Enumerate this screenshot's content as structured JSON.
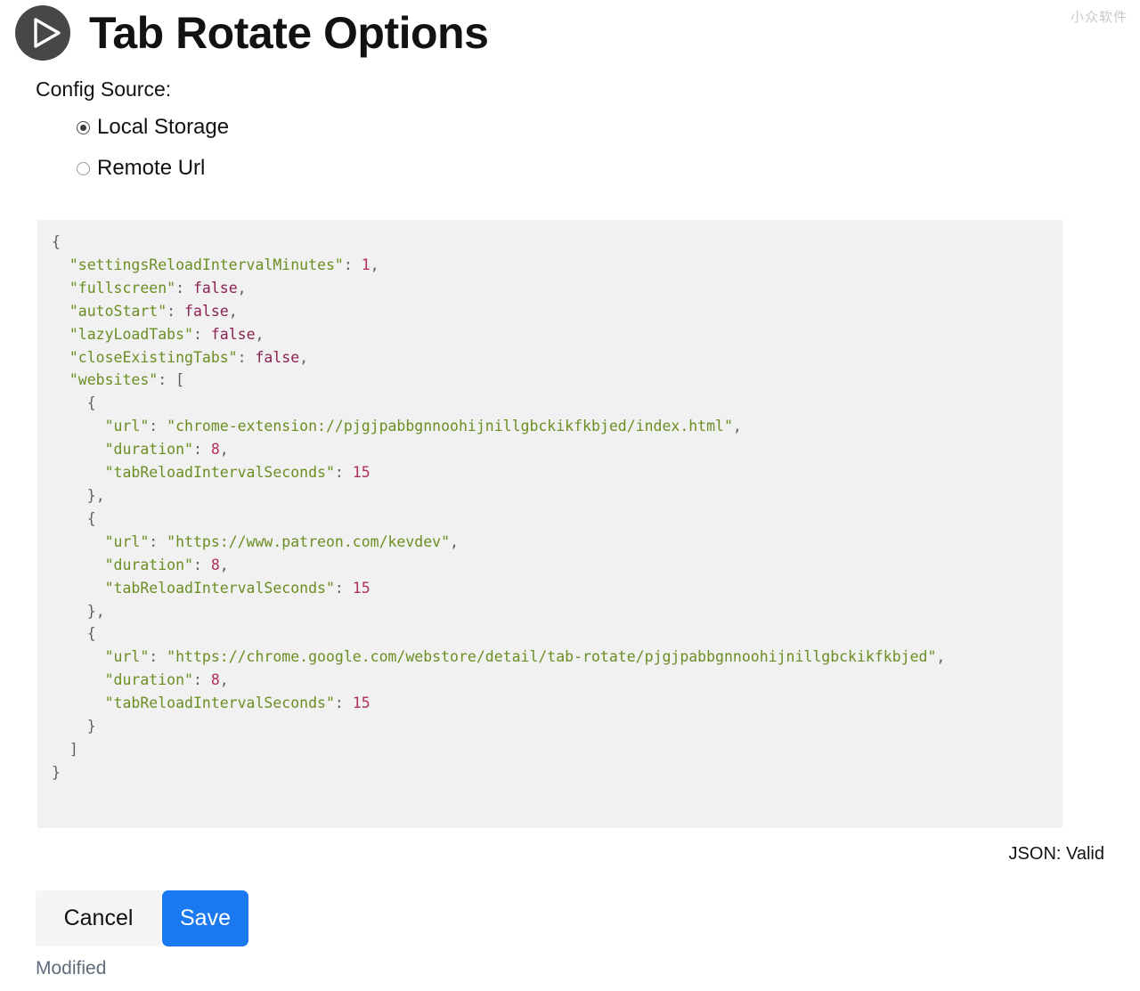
{
  "watermark": "小众软件",
  "header": {
    "title": "Tab Rotate Options",
    "logo_icon": "play-circle-icon"
  },
  "config_source": {
    "label": "Config Source:",
    "options": [
      {
        "label": "Local Storage",
        "selected": true
      },
      {
        "label": "Remote Url",
        "selected": false
      }
    ]
  },
  "editor": {
    "language": "json",
    "background": "#f1f1f1",
    "colors": {
      "key": "#6b8e23",
      "string": "#6b8e23",
      "number": "#b03060",
      "boolean": "#8b2252",
      "punctuation": "#606060"
    },
    "config": {
      "settingsReloadIntervalMinutes": 1,
      "fullscreen": false,
      "autoStart": false,
      "lazyLoadTabs": false,
      "closeExistingTabs": false,
      "websites": [
        {
          "url": "chrome-extension://pjgjpabbgnnoohijnillgbckikfkbjed/index.html",
          "duration": 8,
          "tabReloadIntervalSeconds": 15
        },
        {
          "url": "https://www.patreon.com/kevdev",
          "duration": 8,
          "tabReloadIntervalSeconds": 15
        },
        {
          "url": "https://chrome.google.com/webstore/detail/tab-rotate/pjgjpabbgnnoohijnillgbckikfkbjed",
          "duration": 8,
          "tabReloadIntervalSeconds": 15
        }
      ]
    }
  },
  "status": {
    "json_validity": "JSON: Valid",
    "modified": "Modified"
  },
  "footer": {
    "cancel_label": "Cancel",
    "save_label": "Save",
    "save_color": "#1a78f0"
  }
}
